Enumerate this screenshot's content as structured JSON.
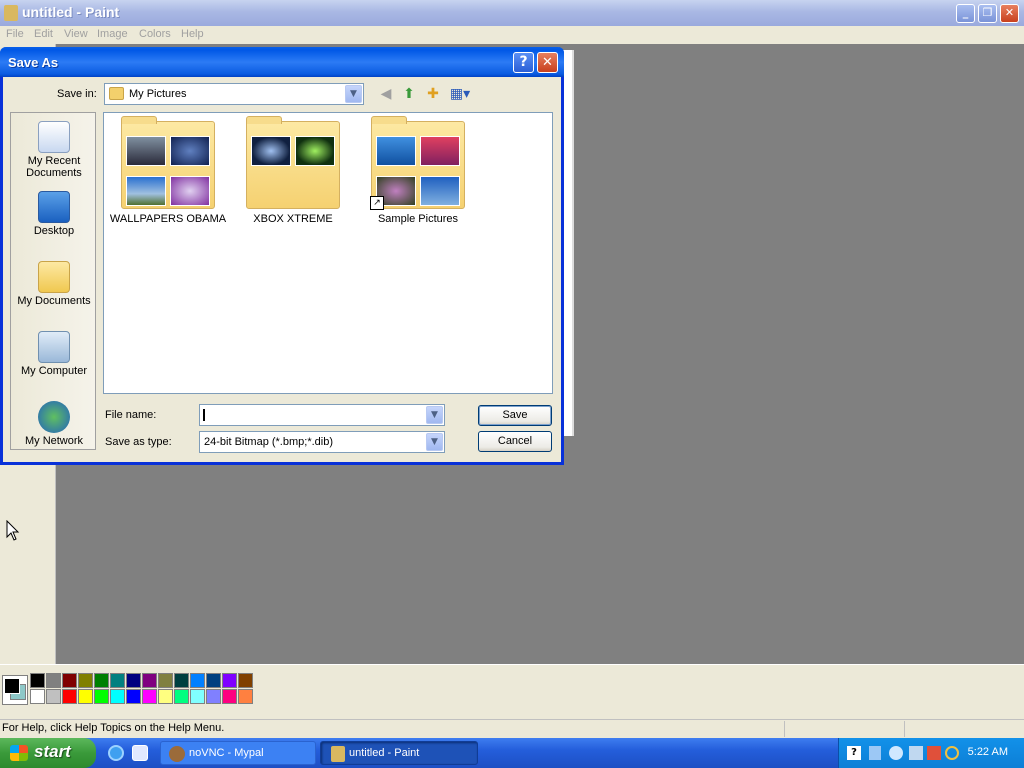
{
  "window": {
    "title": "untitled - Paint",
    "min": "_",
    "max": "❐",
    "close": "✕"
  },
  "menu": [
    "File",
    "Edit",
    "View",
    "Image",
    "Colors",
    "Help"
  ],
  "dialog": {
    "title": "Save As",
    "help": "?",
    "close": "✕",
    "save_in_label": "Save in:",
    "save_in_value": "My Pictures",
    "places": [
      "My Recent Documents",
      "Desktop",
      "My Documents",
      "My Computer",
      "My Network"
    ],
    "folders": [
      "WALLPAPERS OBAMA",
      "XBOX XTREME",
      "Sample Pictures"
    ],
    "file_name_label": "File name:",
    "file_name_value": "",
    "save_as_type_label": "Save as type:",
    "save_as_type_value": "24-bit Bitmap (*.bmp;*.dib)",
    "save_button": "Save",
    "cancel_button": "Cancel"
  },
  "palette": {
    "top": [
      "#000000",
      "#808080",
      "#800000",
      "#808000",
      "#008000",
      "#008080",
      "#000080",
      "#800080",
      "#808040",
      "#004040",
      "#0080ff",
      "#004080",
      "#8000ff",
      "#804000"
    ],
    "bottom": [
      "#ffffff",
      "#c0c0c0",
      "#ff0000",
      "#ffff00",
      "#00ff00",
      "#00ffff",
      "#0000ff",
      "#ff00ff",
      "#ffff80",
      "#00ff80",
      "#80ffff",
      "#8080ff",
      "#ff0080",
      "#ff8040"
    ]
  },
  "status": {
    "text": "For Help, click Help Topics on the Help Menu."
  },
  "taskbar": {
    "start": "start",
    "tasks": [
      "noVNC - Mypal",
      "untitled - Paint"
    ],
    "clock": "5:22 AM"
  }
}
